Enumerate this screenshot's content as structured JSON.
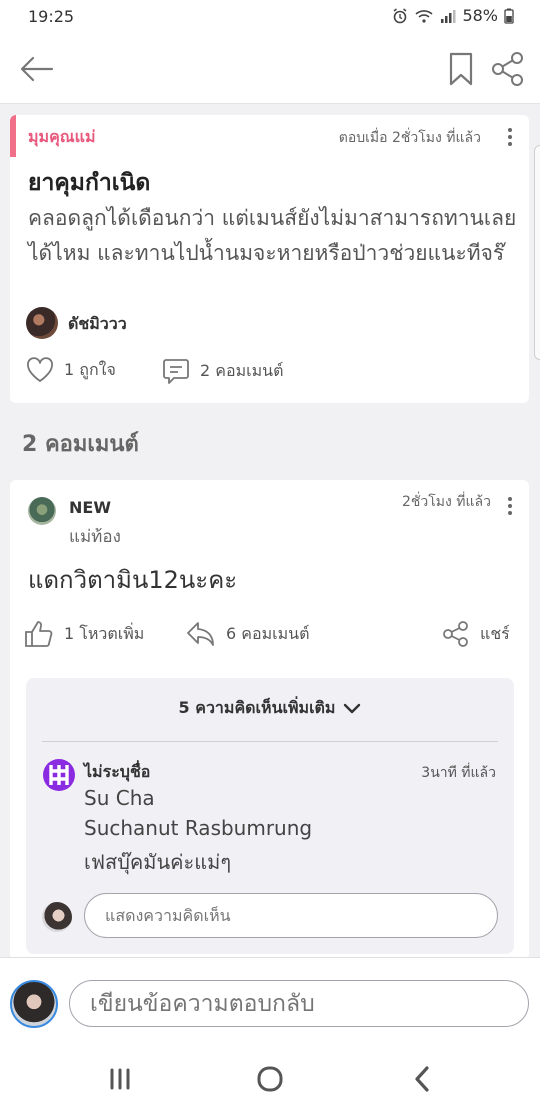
{
  "status_bar": {
    "time": "19:25",
    "battery": "58%"
  },
  "post": {
    "category": "มุมคุณแม่",
    "time": "ตอบเมื่อ 2ชั่วโมง ที่แล้ว",
    "title": "ยาคุมกำเนิด",
    "body": "คลอดลูกได้เดือนกว่า แต่เมนส์ยังไม่มาสามารถทานเลยได้ไหม และทานไปน้ำนมจะหายหรือป่าวช่วยแนะทีจร๊",
    "author": "ดัชมิววว",
    "like_label": "1 ถูกใจ",
    "comment_label": "2 คอมเมนต์"
  },
  "comments_header": "2 คอมเมนต์",
  "comment": {
    "name": "NEW",
    "role": "แม่ท้อง",
    "time": "2ชั่วโมง ที่แล้ว",
    "body": "แดกวิตามิน12นะคะ",
    "vote_label": "1 โหวตเพิ่ม",
    "reply_label": "6 คอมเมนต์",
    "share_label": "แชร์",
    "more_replies": "5 ความคิดเห็นเพิ่มเติม",
    "reply": {
      "name": "ไม่ระบุชื่อ",
      "time": "3นาที ที่แล้ว",
      "lines": [
        "Su Cha",
        "Suchanut Rasbumrung",
        "เฟสบุ๊คมันค่ะแม่ๆ"
      ]
    },
    "reply_placeholder": "แสดงความคิดเห็น"
  },
  "compose_placeholder": "เขียนข้อความตอบกลับ",
  "icons": {
    "back": "arrow-left-icon",
    "bookmark": "bookmark-icon",
    "share": "share-icon",
    "heart": "heart-icon",
    "comment": "comment-icon",
    "thumb": "thumbs-up-icon",
    "reply": "reply-arrow-icon",
    "kebab": "more-vertical-icon"
  },
  "colors": {
    "accent_pink": "#e85a7d",
    "reply_avatar": "#8a2be2",
    "active_avatar_ring": "#3a8ae0"
  }
}
